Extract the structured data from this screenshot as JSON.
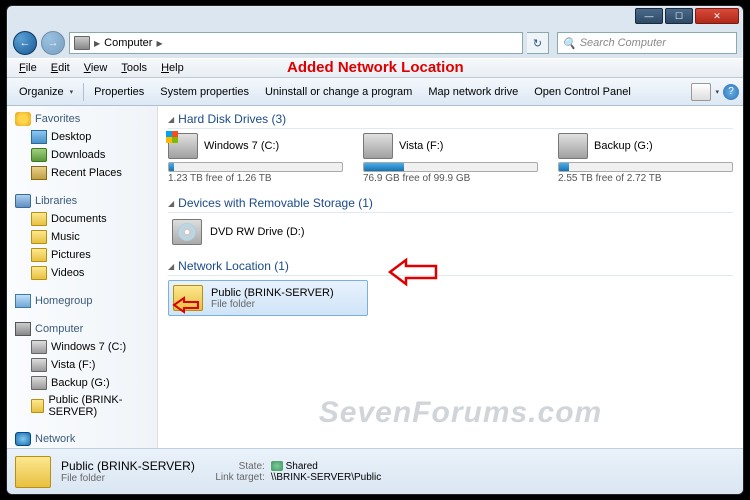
{
  "annotation": "Added Network Location",
  "watermark": "SevenForums.com",
  "address": {
    "root": "Computer"
  },
  "search": {
    "placeholder": "Search Computer"
  },
  "menu": {
    "file": "File",
    "edit": "Edit",
    "view": "View",
    "tools": "Tools",
    "help": "Help"
  },
  "toolbar": {
    "organize": "Organize",
    "properties": "Properties",
    "sysprops": "System properties",
    "uninstall": "Uninstall or change a program",
    "mapdrive": "Map network drive",
    "ctrlpanel": "Open Control Panel"
  },
  "sidebar": {
    "favorites": {
      "label": "Favorites",
      "items": [
        "Desktop",
        "Downloads",
        "Recent Places"
      ]
    },
    "libraries": {
      "label": "Libraries",
      "items": [
        "Documents",
        "Music",
        "Pictures",
        "Videos"
      ]
    },
    "homegroup": "Homegroup",
    "computer": {
      "label": "Computer",
      "items": [
        "Windows 7 (C:)",
        "Vista (F:)",
        "Backup (G:)",
        "Public (BRINK-SERVER)"
      ]
    },
    "network": "Network"
  },
  "sections": {
    "hdd": {
      "label": "Hard Disk Drives (3)",
      "drives": [
        {
          "name": "Windows 7 (C:)",
          "free": "1.23 TB free of 1.26 TB",
          "pct": 3
        },
        {
          "name": "Vista (F:)",
          "free": "76.9 GB free of 99.9 GB",
          "pct": 23
        },
        {
          "name": "Backup (G:)",
          "free": "2.55 TB free of 2.72 TB",
          "pct": 6
        }
      ]
    },
    "removable": {
      "label": "Devices with Removable Storage (1)",
      "item": "DVD RW Drive (D:)"
    },
    "network": {
      "label": "Network Location (1)",
      "item": {
        "name": "Public (BRINK-SERVER)",
        "type": "File folder"
      }
    }
  },
  "details": {
    "name": "Public (BRINK-SERVER)",
    "type": "File folder",
    "state_k": "State:",
    "state_v": "Shared",
    "target_k": "Link target:",
    "target_v": "\\\\BRINK-SERVER\\Public"
  }
}
